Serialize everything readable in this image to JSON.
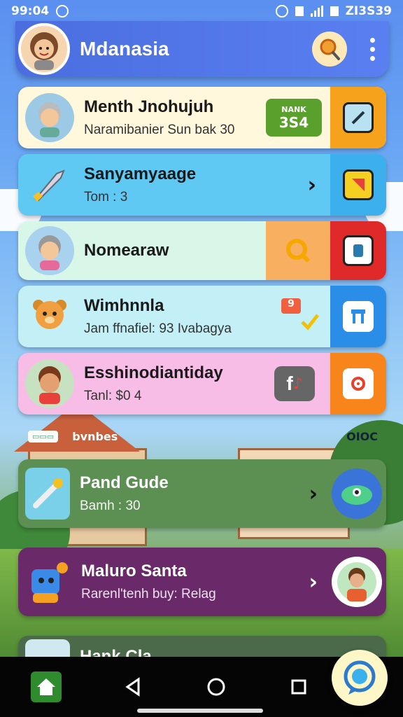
{
  "status_bar": {
    "time": "99:04",
    "right_text": "ZI3S39"
  },
  "app_bar": {
    "title": "Mdanasia"
  },
  "cards": [
    {
      "title": "Menth Jnohujuh",
      "subtitle": "Naramibanier Sun bak 30",
      "badge_top": "NANK",
      "badge_value": "3S4"
    },
    {
      "title": "Sanyamyaage",
      "subtitle": "Tom : 3"
    },
    {
      "title": "Nomearaw",
      "subtitle": ""
    },
    {
      "title": "Wimhnnla",
      "subtitle": "Jam ffnafiel: 93 Ivabagya",
      "badge": "9"
    },
    {
      "title": "Esshinodiantiday",
      "subtitle": "Tanl: $0 4"
    }
  ],
  "separator": {
    "left": "bvnbes",
    "right": "OIOC"
  },
  "lower_cards": [
    {
      "title": "Pand Gude",
      "subtitle": "Bamh : 30"
    },
    {
      "title": "Maluro Santa",
      "subtitle": "Rarenl'tenh buy: Relag"
    },
    {
      "title": "Hank Cla"
    }
  ],
  "colors": {
    "app_bar": "#4a6ee0",
    "nav_bar": "#050505"
  }
}
